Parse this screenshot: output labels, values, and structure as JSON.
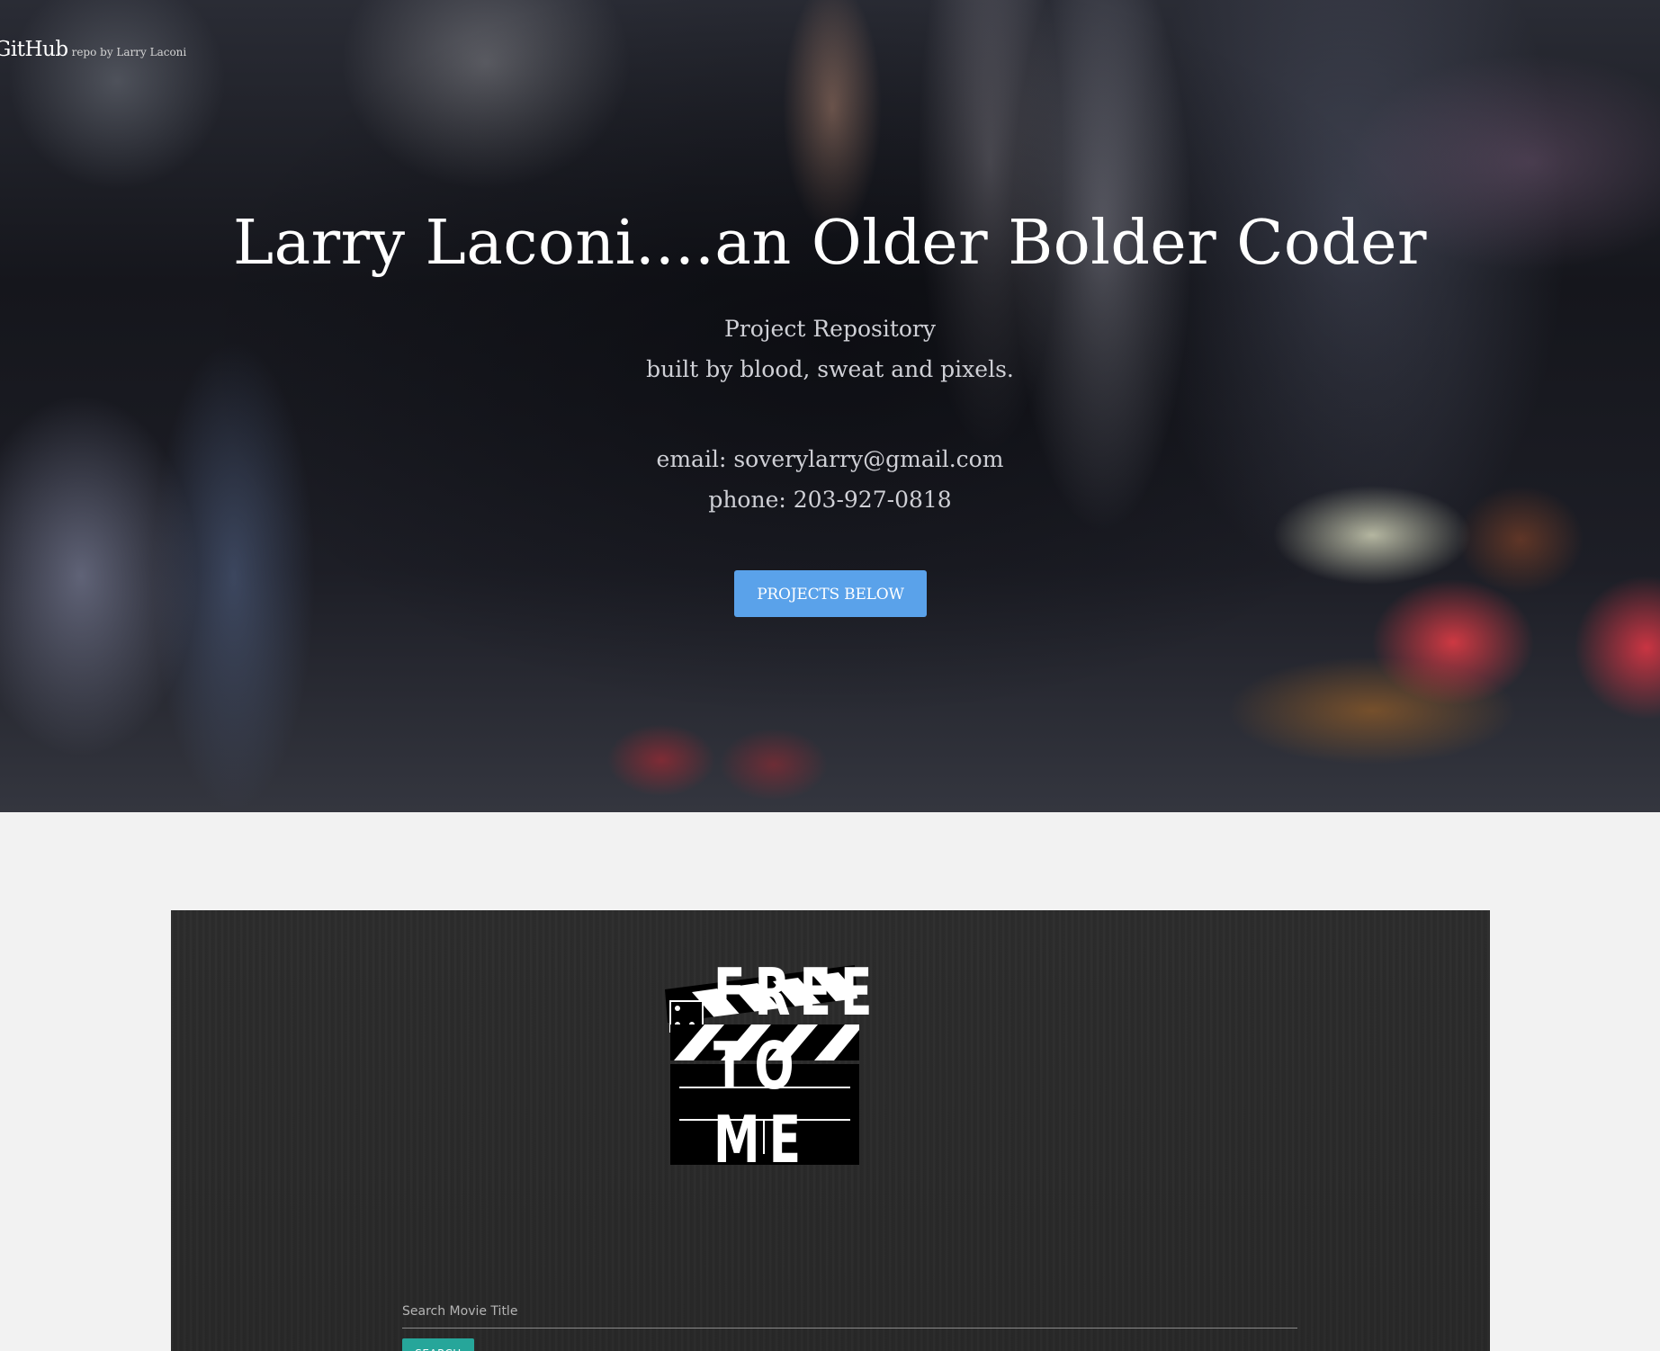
{
  "hero": {
    "brand_main": "GitHub",
    "brand_sub": "repo by Larry Laconi",
    "title": "Larry Laconi....an Older Bolder Coder",
    "tagline_line1": "Project Repository",
    "tagline_line2": "built by blood, sweat and pixels.",
    "email_line": "email: soverylarry@gmail.com",
    "phone_line": "phone: 203-927-0818",
    "button_label": "PROJECTS BELOW",
    "button_color": "#5aa2ea"
  },
  "project": {
    "logo_icon": "clapperboard-icon",
    "logo_words": [
      "FREE",
      "TO",
      "ME"
    ],
    "search_placeholder": "Search Movie Title",
    "search_button_label": "SEARCH",
    "search_button_color": "#26a69a"
  }
}
